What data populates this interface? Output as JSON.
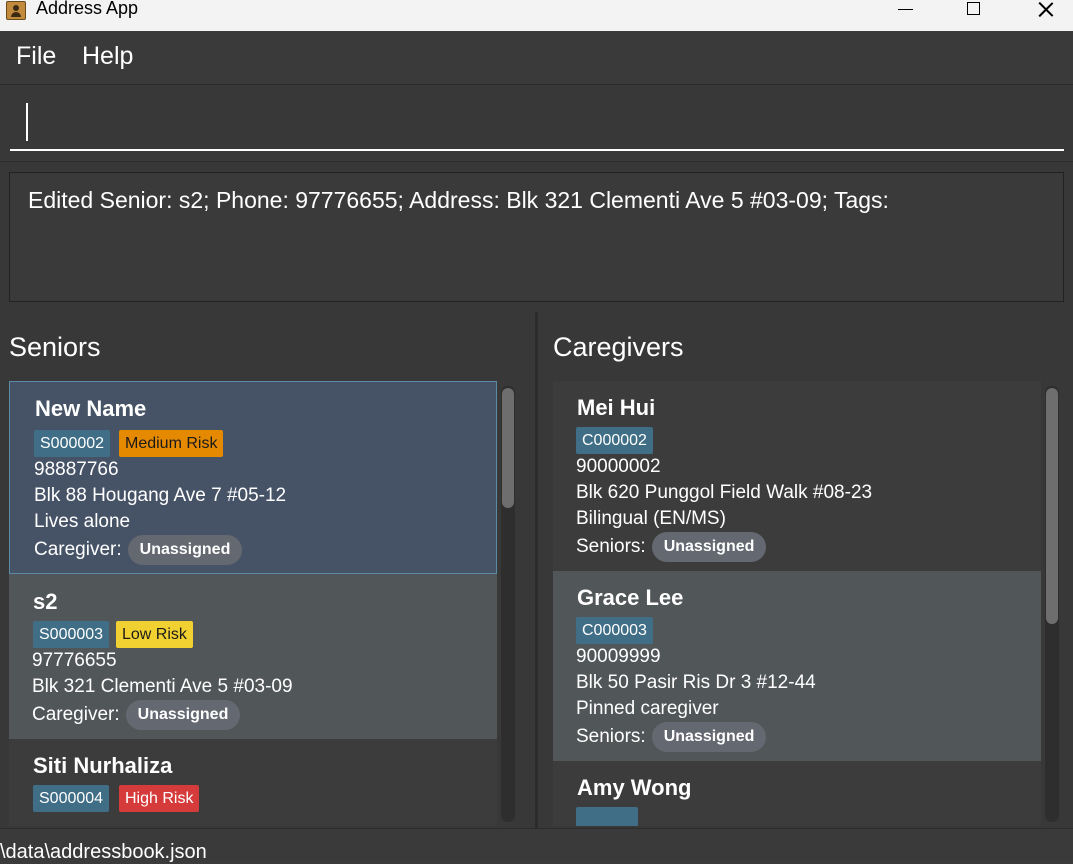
{
  "window": {
    "title": "Address App"
  },
  "menu": {
    "file": "File",
    "help": "Help"
  },
  "command": {
    "value": ""
  },
  "result": {
    "text": "Edited Senior: s2; Phone: 97776655; Address: Blk 321 Clementi Ave 5 #03-09; Tags:"
  },
  "seniors": {
    "title": "Seniors",
    "cards": [
      {
        "name": "New Name",
        "id": "S000002",
        "risk": "Medium Risk",
        "phone": "98887766",
        "address": "Blk 88 Hougang Ave 7 #05-12",
        "note": "Lives alone",
        "caregiver_label": "Caregiver:",
        "caregiver": "Unassigned"
      },
      {
        "name": "s2",
        "id": "S000003",
        "risk": "Low Risk",
        "phone": "97776655",
        "address": "Blk 321 Clementi Ave 5 #03-09",
        "caregiver_label": "Caregiver:",
        "caregiver": "Unassigned"
      },
      {
        "name": "Siti Nurhaliza",
        "id": "S000004",
        "risk": "High Risk"
      }
    ]
  },
  "caregivers": {
    "title": "Caregivers",
    "cards": [
      {
        "name": "Mei Hui",
        "id": "C000002",
        "phone": "90000002",
        "address": "Blk 620 Punggol Field Walk #08-23",
        "note": "Bilingual (EN/MS)",
        "seniors_label": "Seniors:",
        "seniors": "Unassigned"
      },
      {
        "name": "Grace Lee",
        "id": "C000003",
        "phone": "90009999",
        "address": "Blk 50 Pasir Ris Dr 3 #12-44",
        "note": "Pinned caregiver",
        "seniors_label": "Seniors:",
        "seniors": "Unassigned"
      },
      {
        "name": "Amy Wong"
      }
    ]
  },
  "status": {
    "path": "\\data\\addressbook.json"
  },
  "colors": {
    "id_badge": "#3f6e86",
    "medium_risk": "#e58a00",
    "low_risk": "#f1d132",
    "high_risk": "#d63b3b",
    "selected_card": "#465366",
    "alt_card": "#515658"
  }
}
